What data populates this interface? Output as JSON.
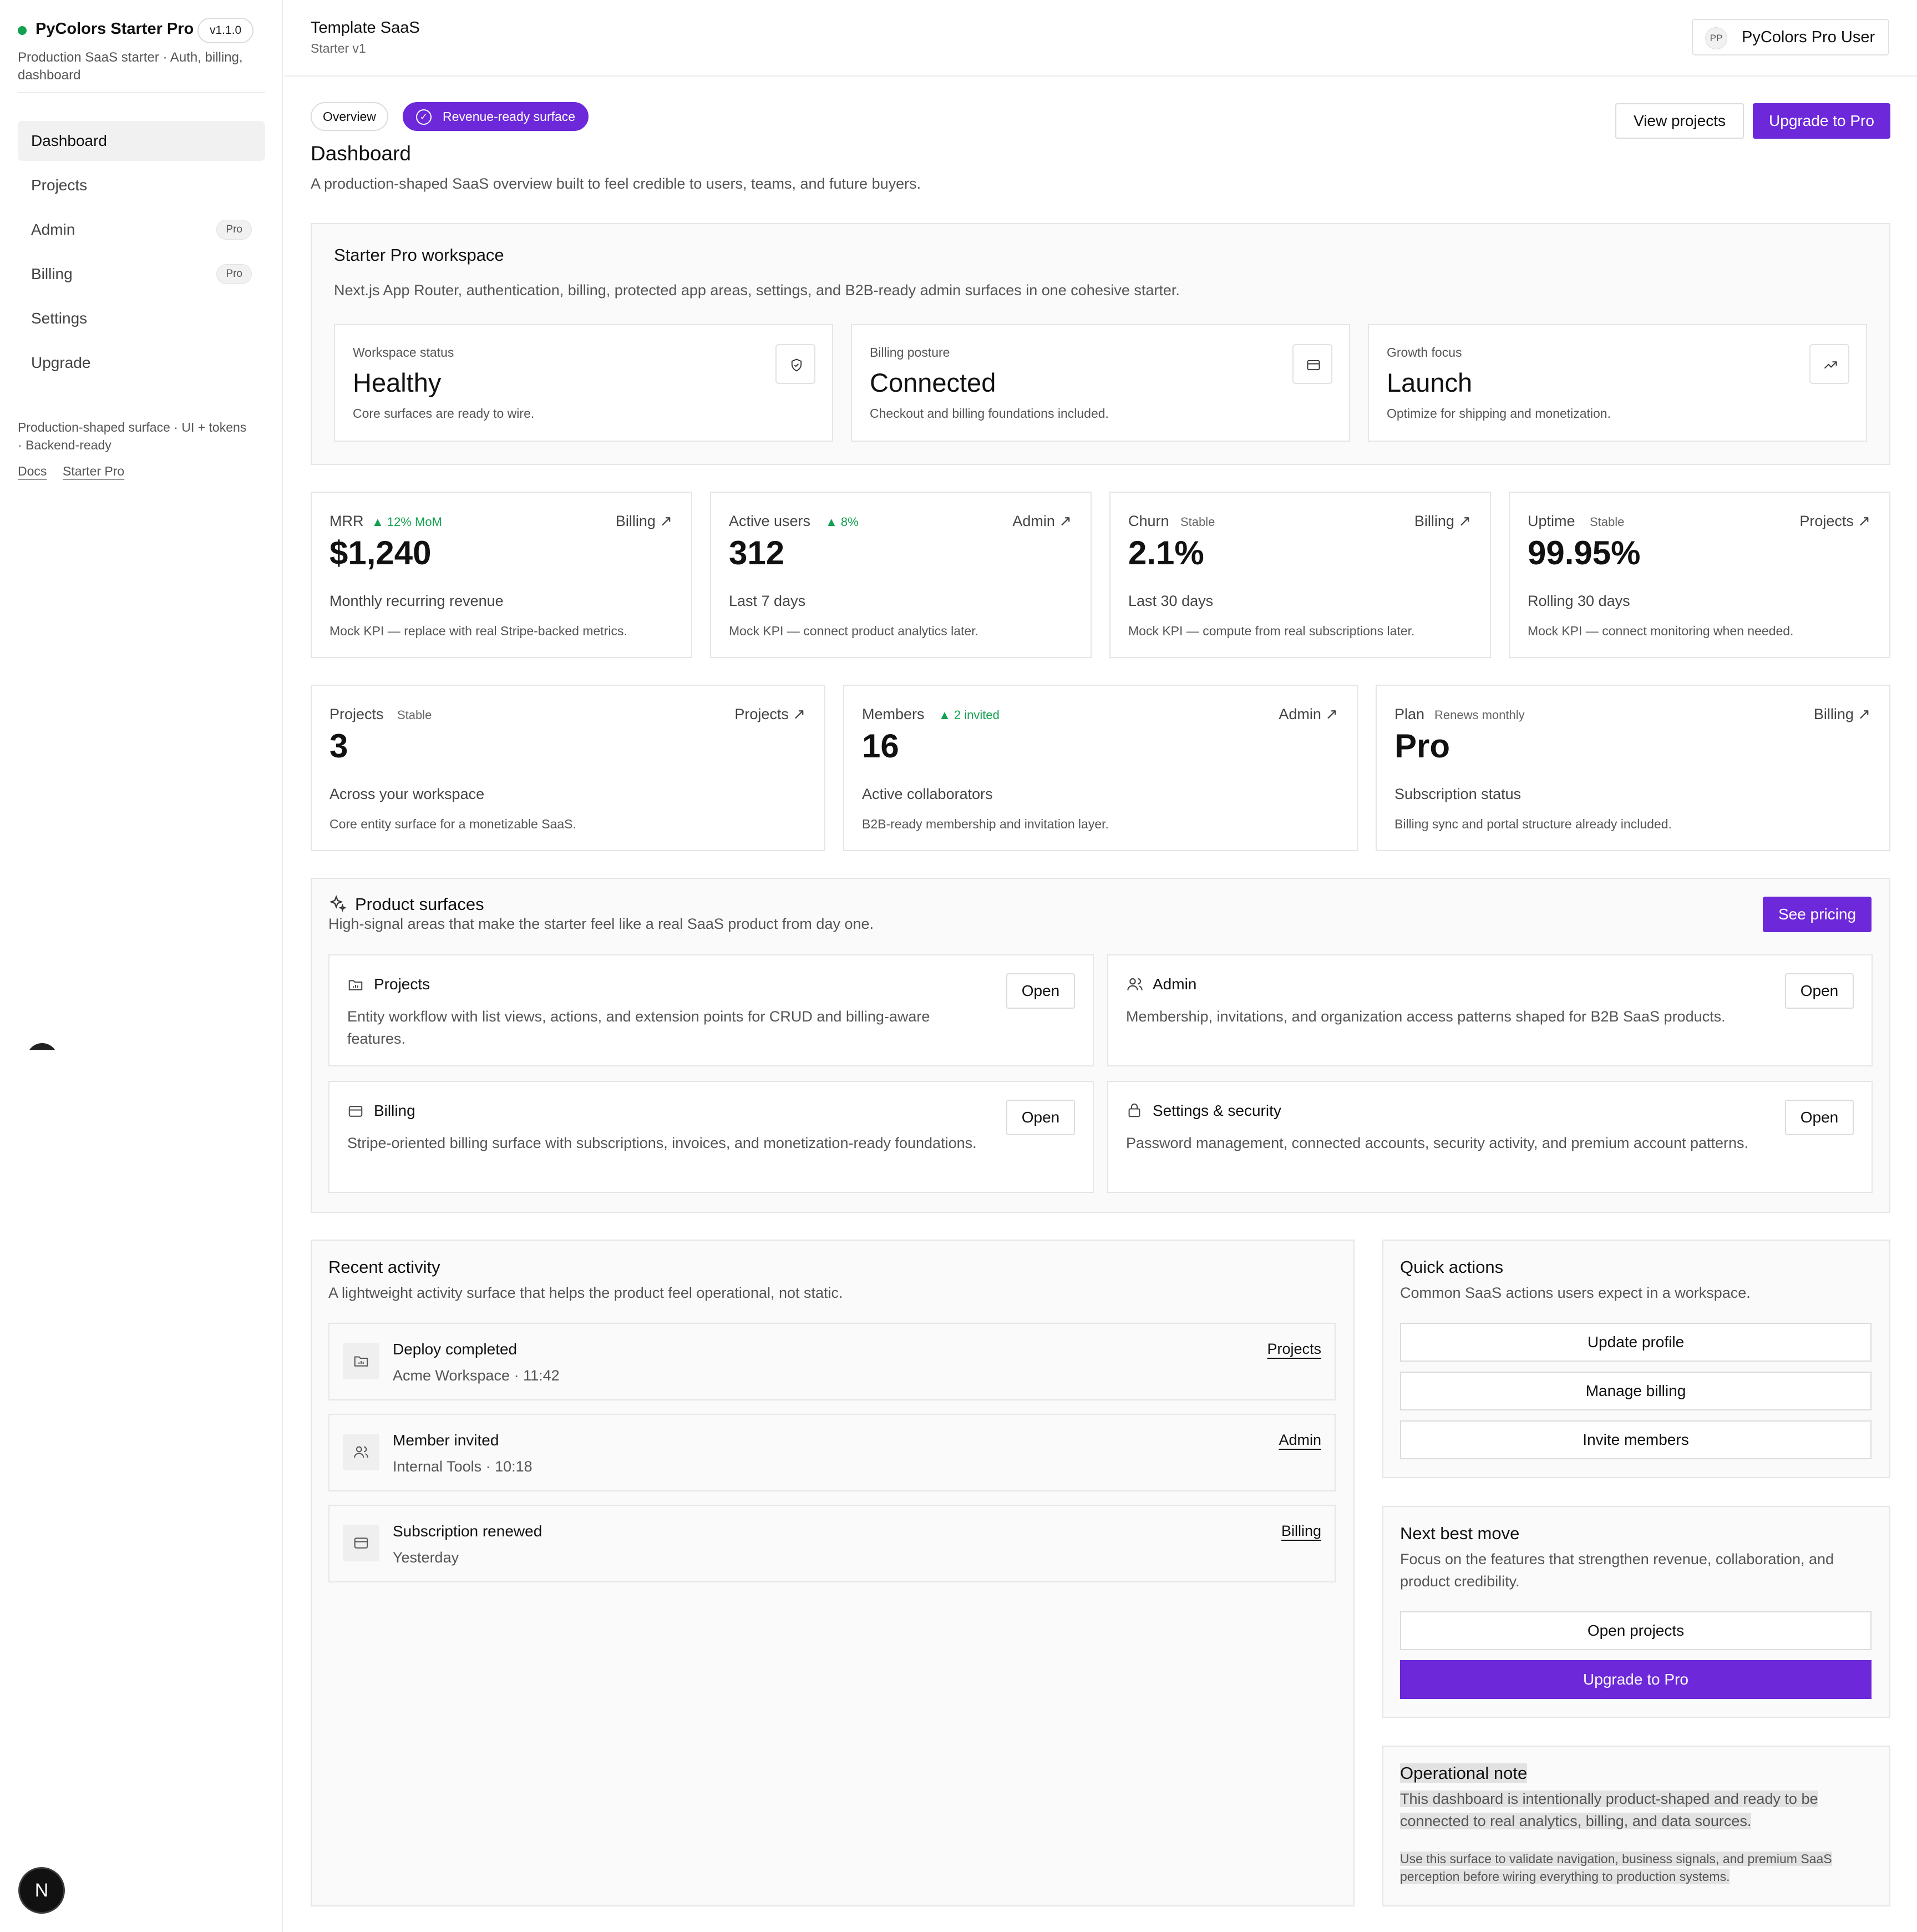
{
  "sidebar": {
    "brand_name": "PyColors Starter Pro",
    "version": "v1.1.0",
    "brand_sub": "Production SaaS starter · Auth, billing, dashboard",
    "nav": [
      {
        "label": "Dashboard",
        "badge": ""
      },
      {
        "label": "Projects",
        "badge": ""
      },
      {
        "label": "Admin",
        "badge": "Pro"
      },
      {
        "label": "Billing",
        "badge": "Pro"
      },
      {
        "label": "Settings",
        "badge": ""
      },
      {
        "label": "Upgrade",
        "badge": ""
      }
    ],
    "footer_text": "Production-shaped surface · UI + tokens · Backend-ready",
    "links": [
      "Docs",
      "Starter Pro"
    ],
    "corner_badge": "N"
  },
  "header": {
    "title": "Template SaaS",
    "subtitle": "Starter v1",
    "user_initials": "PP",
    "user_name": "PyColors Pro User"
  },
  "page": {
    "pill_overview": "Overview",
    "pill_revenue": "Revenue-ready surface",
    "title": "Dashboard",
    "subtitle": "A production-shaped SaaS overview built to feel credible to users, teams, and future buyers.",
    "btn_view_projects": "View projects",
    "btn_upgrade": "Upgrade to Pro"
  },
  "workspace": {
    "title": "Starter Pro workspace",
    "subtitle": "Next.js App Router, authentication, billing, protected app areas, settings, and B2B-ready admin surfaces in one cohesive starter.",
    "stats": [
      {
        "label": "Workspace status",
        "value": "Healthy",
        "desc": "Core surfaces are ready to wire.",
        "icon": "shield-icon"
      },
      {
        "label": "Billing posture",
        "value": "Connected",
        "desc": "Checkout and billing foundations included.",
        "icon": "credit-card-icon"
      },
      {
        "label": "Growth focus",
        "value": "Launch",
        "desc": "Optimize for shipping and monetization.",
        "icon": "trending-up-icon"
      }
    ]
  },
  "kpis": [
    {
      "label": "MRR",
      "delta": "▲ 12% MoM",
      "link": "Billing",
      "value": "$1,240",
      "desc": "Monthly recurring revenue",
      "note": "Mock KPI — replace with real Stripe-backed metrics."
    },
    {
      "label": "Active users",
      "delta": "▲ 8%",
      "link": "Admin",
      "value": "312",
      "desc": "Last 7 days",
      "note": "Mock KPI — connect product analytics later."
    },
    {
      "label": "Churn",
      "stable": "Stable",
      "link": "Billing",
      "value": "2.1%",
      "desc": "Last 30 days",
      "note": "Mock KPI — compute from real subscriptions later."
    },
    {
      "label": "Uptime",
      "stable": "Stable",
      "link": "Projects",
      "value": "99.95%",
      "desc": "Rolling 30 days",
      "note": "Mock KPI — connect monitoring when needed."
    }
  ],
  "kpis2": [
    {
      "label": "Projects",
      "stable": "Stable",
      "link": "Projects",
      "value": "3",
      "desc": "Across your workspace",
      "note": "Core entity surface for a monetizable SaaS."
    },
    {
      "label": "Members",
      "delta": "▲ 2 invited",
      "link": "Admin",
      "value": "16",
      "desc": "Active collaborators",
      "note": "B2B-ready membership and invitation layer."
    },
    {
      "label": "Plan",
      "stable": "Renews monthly",
      "link": "Billing",
      "value": "Pro",
      "desc": "Subscription status",
      "note": "Billing sync and portal structure already included."
    }
  ],
  "surfaces": {
    "title": "Product surfaces",
    "subtitle": "High-signal areas that make the starter feel like a real SaaS product from day one.",
    "see_pricing": "See pricing",
    "open_label": "Open",
    "items": [
      {
        "title": "Projects",
        "desc": "Entity workflow with list views, actions, and extension points for CRUD and billing-aware features."
      },
      {
        "title": "Admin",
        "desc": "Membership, invitations, and organization access patterns shaped for B2B SaaS products."
      },
      {
        "title": "Billing",
        "desc": "Stripe-oriented billing surface with subscriptions, invoices, and monetization-ready foundations."
      },
      {
        "title": "Settings & security",
        "desc": "Password management, connected accounts, security activity, and premium account patterns."
      }
    ]
  },
  "activity": {
    "title": "Recent activity",
    "subtitle": "A lightweight activity surface that helps the product feel operational, not static.",
    "items": [
      {
        "title": "Deploy completed",
        "meta": "Acme Workspace · 11:42",
        "link": "Projects"
      },
      {
        "title": "Member invited",
        "meta": "Internal Tools · 10:18",
        "link": "Admin"
      },
      {
        "title": "Subscription renewed",
        "meta": "Yesterday",
        "link": "Billing"
      }
    ]
  },
  "quick_actions": {
    "title": "Quick actions",
    "subtitle": "Common SaaS actions users expect in a workspace.",
    "buttons": [
      "Update profile",
      "Manage billing",
      "Invite members"
    ]
  },
  "next_move": {
    "title": "Next best move",
    "subtitle": "Focus on the features that strengthen revenue, collaboration, and product credibility.",
    "btn_open": "Open projects",
    "btn_upgrade": "Upgrade to Pro"
  },
  "op_note": {
    "title": "Operational note",
    "body": "This dashboard is intentionally product-shaped and ready to be connected to real analytics, billing, and data sources.",
    "small": "Use this surface to validate navigation, business signals, and premium SaaS perception before wiring everything to production systems."
  },
  "colors": {
    "accent": "#6d28d9",
    "positive": "#12a150"
  }
}
